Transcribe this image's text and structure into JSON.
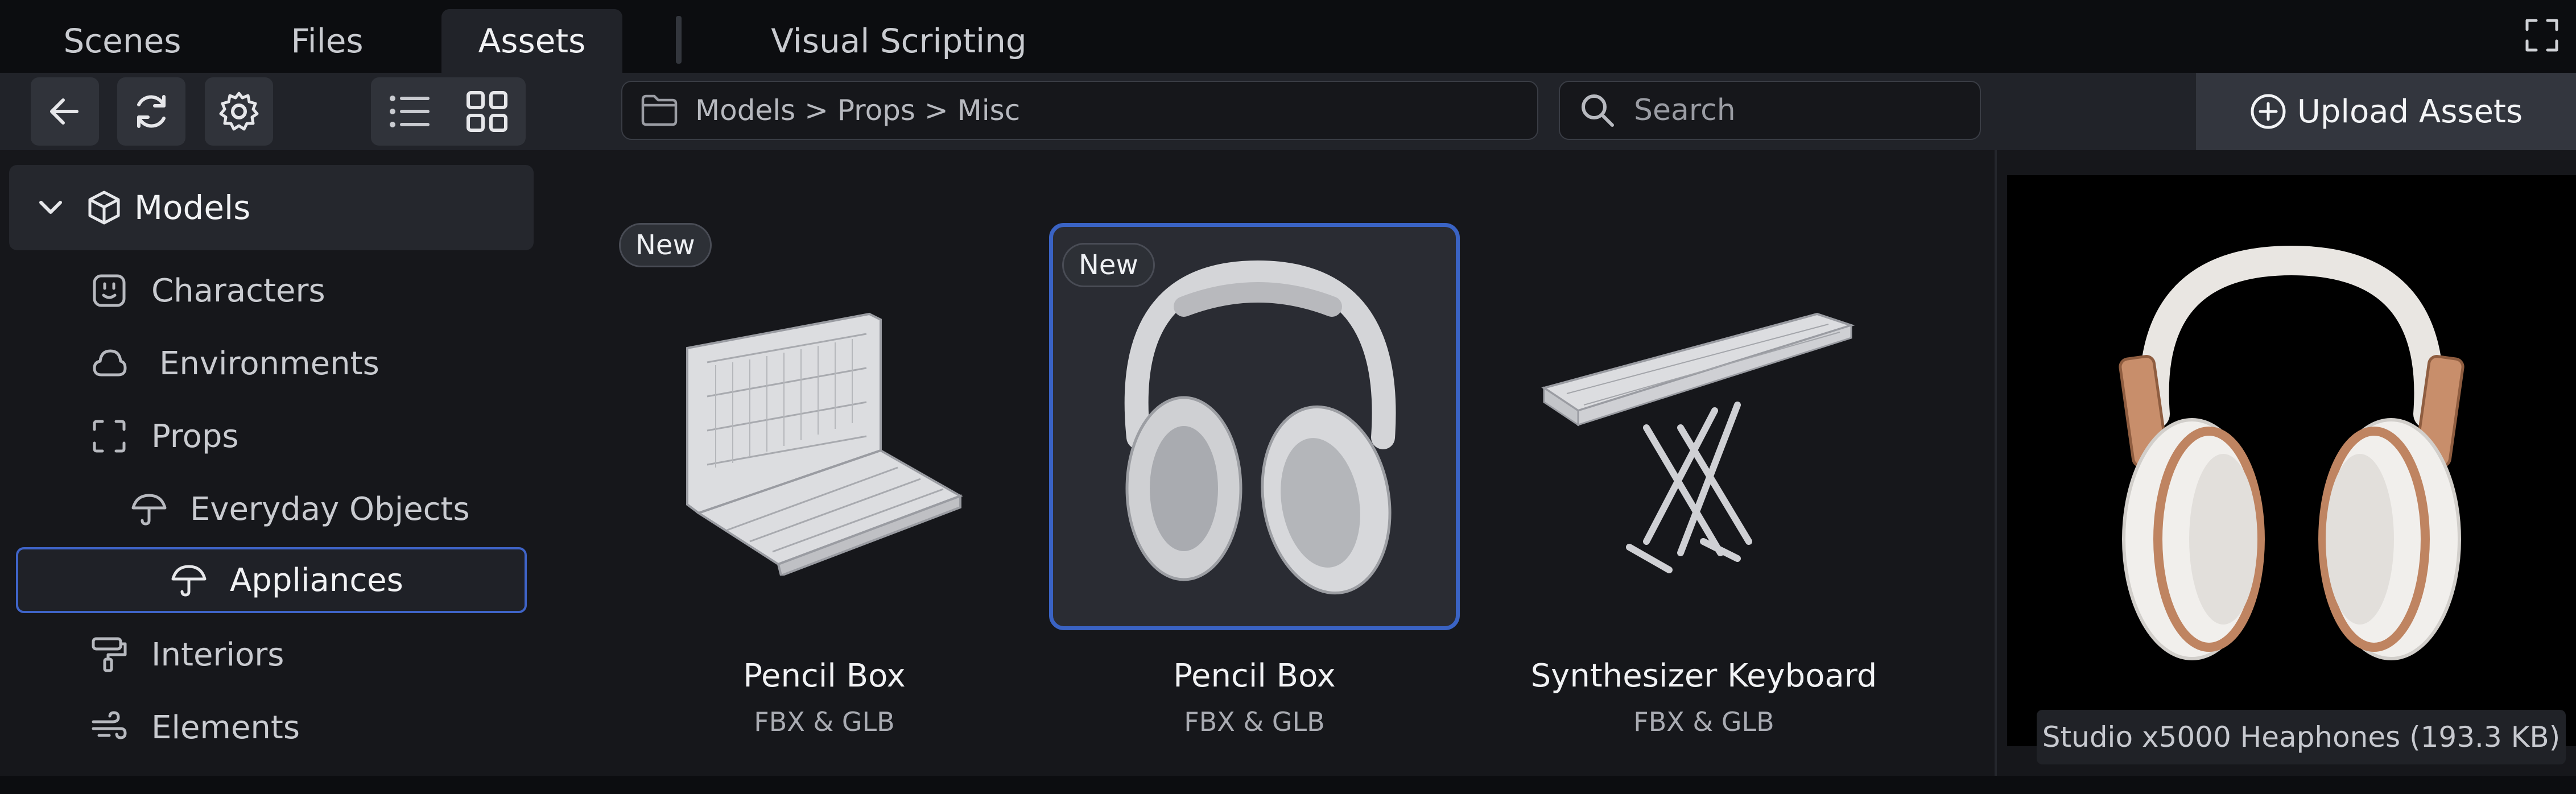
{
  "tabs": [
    "Scenes",
    "Files",
    "Assets",
    "Visual Scripting"
  ],
  "toolbar": {
    "breadcrumb": "Models > Props > Misc",
    "search_placeholder": "Search",
    "upload_label": "Upload Assets"
  },
  "sidebar": {
    "root": "Models",
    "items": [
      {
        "label": "Characters",
        "icon": "character-icon"
      },
      {
        "label": "Environments",
        "icon": "cloud-icon"
      },
      {
        "label": "Props",
        "icon": "props-icon"
      },
      {
        "label": "Everyday Objects",
        "icon": "umbrella-icon"
      },
      {
        "label": "Appliances",
        "icon": "umbrella-icon"
      },
      {
        "label": "Interiors",
        "icon": "paint-roller-icon"
      },
      {
        "label": "Elements",
        "icon": "wind-icon"
      }
    ]
  },
  "assets": [
    {
      "title": "Pencil Box",
      "format": "FBX & GLB",
      "badge": "New"
    },
    {
      "title": "Pencil Box",
      "format": "FBX & GLB",
      "badge": "New"
    },
    {
      "title": "Synthesizer Keyboard",
      "format": "FBX & GLB",
      "badge": ""
    }
  ],
  "preview": {
    "caption": "Studio x5000 Heaphones (193.3 KB)"
  },
  "colors": {
    "accent": "#3a63c4",
    "background": "#16171b",
    "toolbar": "#212329"
  }
}
